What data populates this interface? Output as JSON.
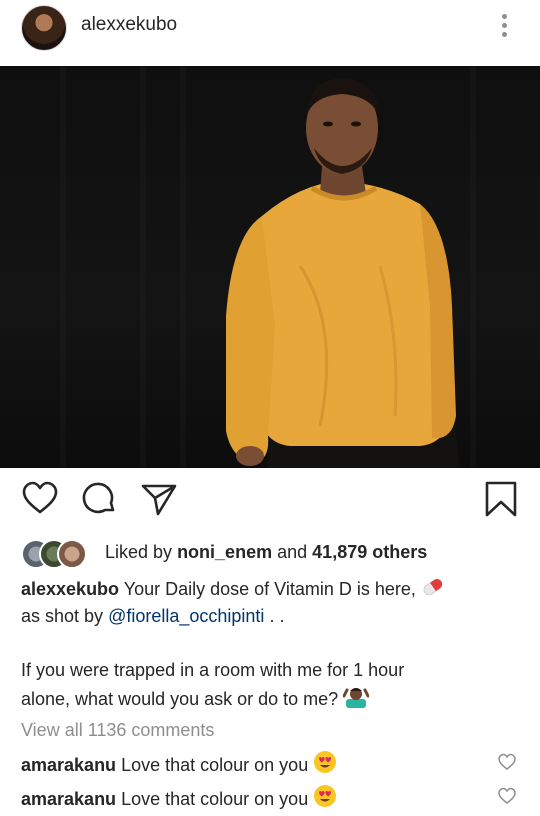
{
  "post": {
    "username": "alexxekubo",
    "likes": {
      "prefix": "Liked by",
      "first_liker": "noni_enem",
      "joiner": "and",
      "count_text": "41,879 others"
    },
    "caption": {
      "author": "alexxekubo",
      "line1": "Your Daily dose of Vitamin D is here,",
      "line2_prefix": "as shot by",
      "mention": "@fiorella_occhipinti",
      "line2_suffix": ". .",
      "line3": "If you were trapped in a room with me for 1 hour",
      "line4": "alone, what would you ask or do to me?"
    },
    "view_all_comments": "View all 1136 comments",
    "comments": [
      {
        "user": "amarakanu",
        "text": "Love that colour on you"
      },
      {
        "user": "amarakanu",
        "text": "Love that colour on you"
      }
    ]
  },
  "colors": {
    "sweater": "#e8a73a",
    "mention": "#003569",
    "secondary_text": "#8e8e8e"
  },
  "icons": [
    "more-vertical-icon",
    "heart-icon",
    "comment-icon",
    "share-icon",
    "bookmark-icon",
    "pill-emoji",
    "shrug-emoji",
    "heart-eyes-emoji"
  ]
}
